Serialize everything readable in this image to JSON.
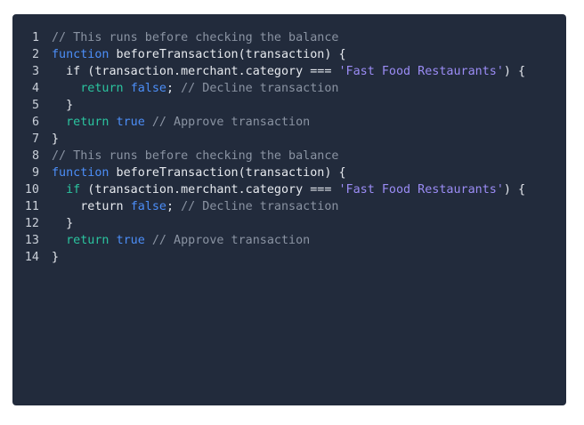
{
  "editor": {
    "lines": [
      {
        "n": "1",
        "tokens": [
          {
            "t": "// This runs before checking the balance",
            "c": "cmt"
          }
        ]
      },
      {
        "n": "2",
        "tokens": [
          {
            "t": "function",
            "c": "kw"
          },
          {
            "t": " beforeTransaction(transaction) {",
            "c": "pl"
          }
        ]
      },
      {
        "n": "3",
        "tokens": [
          {
            "t": "  if (transaction.merchant.category === ",
            "c": "pl"
          },
          {
            "t": "'Fast Food Restaurants'",
            "c": "str"
          },
          {
            "t": ") {",
            "c": "pl"
          }
        ]
      },
      {
        "n": "4",
        "tokens": [
          {
            "t": "    ",
            "c": "pl"
          },
          {
            "t": "return",
            "c": "ret"
          },
          {
            "t": " ",
            "c": "pl"
          },
          {
            "t": "false",
            "c": "bool"
          },
          {
            "t": "; ",
            "c": "pl"
          },
          {
            "t": "// Decline transaction",
            "c": "cmt"
          }
        ]
      },
      {
        "n": "5",
        "tokens": [
          {
            "t": "  }",
            "c": "pl"
          }
        ]
      },
      {
        "n": "6",
        "tokens": [
          {
            "t": "  ",
            "c": "pl"
          },
          {
            "t": "return",
            "c": "ret"
          },
          {
            "t": " ",
            "c": "pl"
          },
          {
            "t": "true",
            "c": "bool"
          },
          {
            "t": " ",
            "c": "pl"
          },
          {
            "t": "// Approve transaction",
            "c": "cmt"
          }
        ]
      },
      {
        "n": "7",
        "tokens": [
          {
            "t": "}",
            "c": "pl"
          }
        ]
      },
      {
        "n": "8",
        "tokens": [
          {
            "t": "// This runs before checking the balance",
            "c": "cmt"
          }
        ]
      },
      {
        "n": "9",
        "tokens": [
          {
            "t": "function",
            "c": "kw"
          },
          {
            "t": " beforeTransaction(transaction) {",
            "c": "pl"
          }
        ]
      },
      {
        "n": "10",
        "tokens": [
          {
            "t": "  ",
            "c": "pl"
          },
          {
            "t": "if",
            "c": "ret"
          },
          {
            "t": " (transaction.merchant.category === ",
            "c": "pl"
          },
          {
            "t": "'Fast Food Restaurants'",
            "c": "str"
          },
          {
            "t": ") {",
            "c": "pl"
          }
        ]
      },
      {
        "n": "11",
        "tokens": [
          {
            "t": "    return ",
            "c": "pl"
          },
          {
            "t": "false",
            "c": "bool"
          },
          {
            "t": "; ",
            "c": "pl"
          },
          {
            "t": "// Decline transaction",
            "c": "cmt"
          }
        ]
      },
      {
        "n": "12",
        "tokens": [
          {
            "t": "  }",
            "c": "pl"
          }
        ]
      },
      {
        "n": "13",
        "tokens": [
          {
            "t": "  ",
            "c": "pl"
          },
          {
            "t": "return",
            "c": "ret"
          },
          {
            "t": " ",
            "c": "pl"
          },
          {
            "t": "true",
            "c": "bool"
          },
          {
            "t": " ",
            "c": "pl"
          },
          {
            "t": "// Approve transaction",
            "c": "cmt"
          }
        ]
      },
      {
        "n": "14",
        "tokens": [
          {
            "t": "}",
            "c": "pl"
          }
        ]
      }
    ]
  }
}
